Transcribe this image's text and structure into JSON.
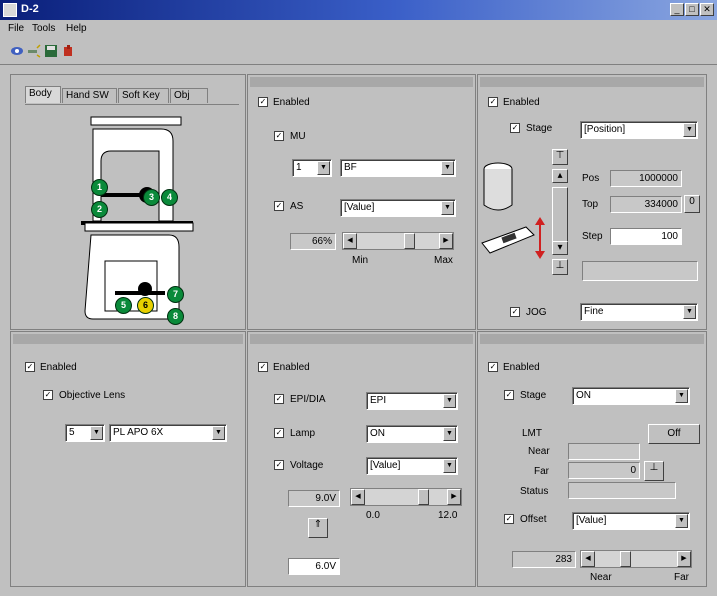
{
  "window": {
    "title": "D-2"
  },
  "menu": [
    "File",
    "Tools",
    "Help"
  ],
  "toolbar": {
    "icons": [
      "eye-icon",
      "light-icon",
      "save-icon",
      "microscope-icon"
    ]
  },
  "body_panel": {
    "tabs": [
      "Body",
      "Hand SW",
      "Soft Key",
      "Obj"
    ],
    "positions": [
      "1",
      "2",
      "3",
      "4",
      "5",
      "6",
      "7",
      "8"
    ],
    "selected_position": "6"
  },
  "panel_tr1": {
    "enabled": "Enabled",
    "mu": {
      "label": "MU",
      "number": "1",
      "value": "BF"
    },
    "as": {
      "label": "AS",
      "value": "[Value]",
      "percent": "66%",
      "min": "Min",
      "max": "Max",
      "level": 0.66
    }
  },
  "panel_tr2": {
    "enabled": "Enabled",
    "stage": {
      "label": "Stage",
      "value": "[Position]"
    },
    "pos": {
      "label": "Pos",
      "value": "1000000"
    },
    "top": {
      "label": "Top",
      "value": "334000",
      "set": "0"
    },
    "step": {
      "label": "Step",
      "value": "100"
    },
    "jog": {
      "label": "JOG",
      "value": "Fine"
    }
  },
  "panel_bl": {
    "enabled": "Enabled",
    "objective": {
      "label": "Objective Lens",
      "number": "5",
      "value": "PL APO 6X"
    }
  },
  "panel_bm": {
    "enabled": "Enabled",
    "epi": {
      "label": "EPI/DIA",
      "value": "EPI"
    },
    "lamp": {
      "label": "Lamp",
      "value": "ON"
    },
    "voltage": {
      "label": "Voltage",
      "value": "[Value]",
      "readout": "9.0V",
      "min": "0.0",
      "max": "12.0",
      "level": 0.75
    },
    "preset": "6.0V"
  },
  "panel_br": {
    "enabled": "Enabled",
    "stage": {
      "label": "Stage",
      "value": "ON"
    },
    "lmt": "LMT",
    "off": "Off",
    "near": "Near",
    "far": {
      "label": "Far",
      "value": "0"
    },
    "status": "Status",
    "offset": {
      "label": "Offset",
      "value": "[Value]",
      "readout": "283",
      "min": "Near",
      "max": "Far",
      "level": 0.35
    }
  },
  "colors": {
    "title_bar": "#0a1f7a",
    "position_marker": "#0a8a3a",
    "selected_marker": "#e8d000"
  }
}
